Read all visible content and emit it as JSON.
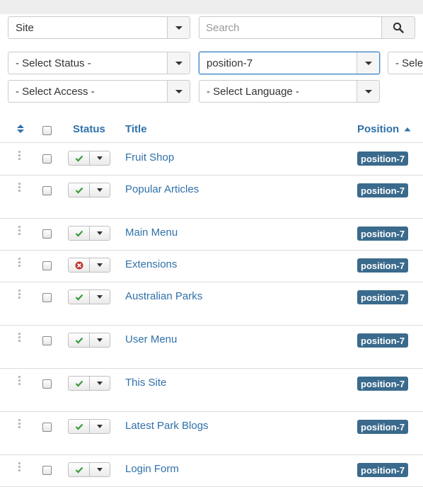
{
  "filters": {
    "site": "Site",
    "search_placeholder": "Search",
    "status": "- Select Status -",
    "position": "position-7",
    "partial": "- Sele",
    "access": "- Select Access -",
    "language": "- Select Language -"
  },
  "table": {
    "headers": {
      "status": "Status",
      "title": "Title",
      "position": "Position"
    },
    "rows": [
      {
        "title": "Fruit Shop",
        "status": "published",
        "position": "position-7"
      },
      {
        "title": "Popular Articles",
        "status": "published",
        "position": "position-7"
      },
      {
        "title": "Main Menu",
        "status": "published",
        "position": "position-7"
      },
      {
        "title": "Extensions",
        "status": "unpublished",
        "position": "position-7"
      },
      {
        "title": "Australian Parks",
        "status": "published",
        "position": "position-7"
      },
      {
        "title": "User Menu",
        "status": "published",
        "position": "position-7"
      },
      {
        "title": "This Site",
        "status": "published",
        "position": "position-7"
      },
      {
        "title": "Latest Park Blogs",
        "status": "published",
        "position": "position-7"
      },
      {
        "title": "Login Form",
        "status": "published",
        "position": "position-7"
      }
    ]
  },
  "colors": {
    "link": "#3071a9",
    "badge": "#3a6a8c",
    "published": "#3c9a3c",
    "unpublished": "#bd362f"
  }
}
